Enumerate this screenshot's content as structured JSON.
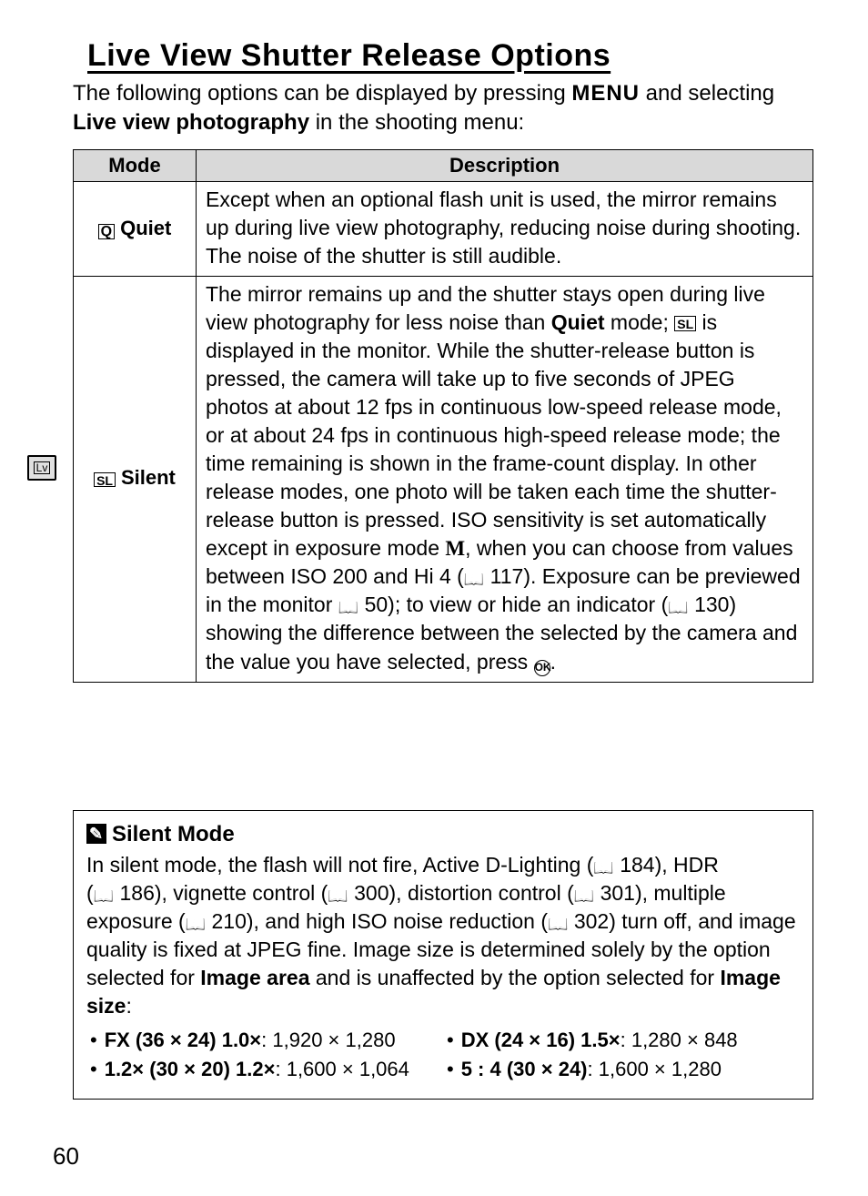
{
  "title": "Live View Shutter Release Options",
  "intro_pre": "The following options can be displayed by pressing ",
  "intro_menu": "MENU",
  "intro_mid": " and selecting ",
  "intro_bold": "Live view photography",
  "intro_post": " in the shooting menu:",
  "table": {
    "head_mode": "Mode",
    "head_desc": "Description",
    "rows": [
      {
        "icon": "Q",
        "mode": "Quiet",
        "desc": "Except when an optional flash unit is used, the mirror remains up during live view photography, reducing noise during shooting.  The noise of the shutter is still audible."
      },
      {
        "icon": "SL",
        "mode": "Silent",
        "desc_parts": {
          "p1": "The mirror remains up and the shutter stays open during live view photography for less noise than ",
          "p1_bold": "Quiet",
          "p1b": " mode; ",
          "p1_icon": "SL",
          "p2": " is displayed in the monitor. While the shutter-release button is pressed, the camera will take up to five seconds of JPEG photos at about 12 fps in continuous low-speed release mode, or at about 24 fps in continuous high-speed release mode; the time remaining is shown in the frame-count display. In other release modes, one photo will be taken each time the shutter-release button is pressed. ISO sensitivity is set automatically except in exposure mode ",
          "p2_mode": "M",
          "p3": ", when you can choose from values between ISO 200 and Hi 4 (",
          "ref1": "117",
          "p4": "). Exposure can be previewed in the monitor ",
          "ref2": "50",
          "p5": "); to view or hide an indicator (",
          "ref3": "130",
          "p6": ") showing the difference between the selected by the camera and the value you have selected, press ",
          "ok": "OK",
          "p7": "."
        }
      }
    ]
  },
  "note": {
    "title": "Silent Mode",
    "body_parts": {
      "a": "In silent mode, the flash will not fire, Active D-Lighting (",
      "r1": "184",
      "b": "), HDR (",
      "r2": "186",
      "c": "), vignette control (",
      "r3": "300",
      "d": "), distortion control (",
      "r4": "301",
      "e": "), multiple exposure (",
      "r5": "210",
      "f": "), and high ISO noise reduction (",
      "r6": "302",
      "g": ") turn off, and image quality is fixed at JPEG fine.  Image size is determined solely by the option selected for ",
      "g_bold1": "Image area",
      "h": " and is unaffected by the option selected for ",
      "h_bold2": "Image size",
      "i": ":"
    },
    "sizes": [
      {
        "label": "FX (36 × 24) 1.0×",
        "value": "1,920 × 1,280"
      },
      {
        "label": "1.2× (30 × 20) 1.2×",
        "value": "1,600 × 1,064"
      },
      {
        "label": "DX (24 × 16) 1.5×",
        "value": "1,280 × 848"
      },
      {
        "label": "5 : 4 (30 × 24)",
        "value": "1,600 × 1,280"
      }
    ]
  },
  "page_number": "60",
  "side_tab_label": "Lv"
}
